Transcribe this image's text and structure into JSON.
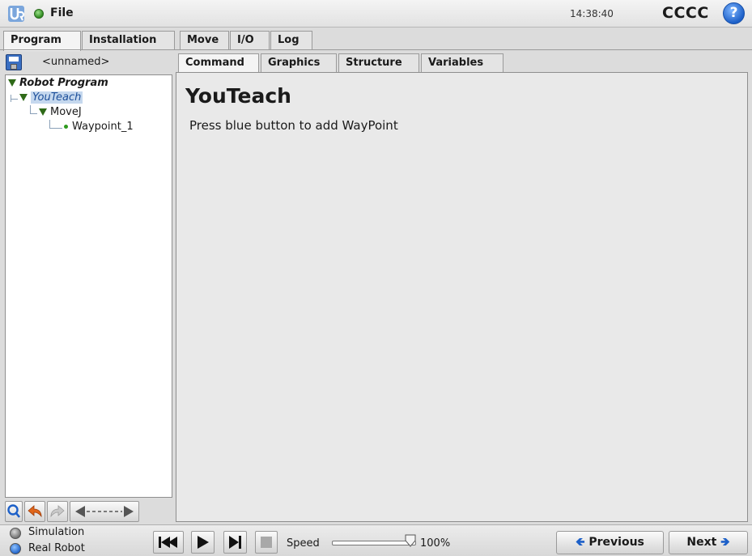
{
  "topbar": {
    "file_label": "File",
    "clock": "14:38:40",
    "robot_name": "CCCC",
    "help_label": "?"
  },
  "main_tabs": [
    "Program",
    "Installation",
    "Move",
    "I/O",
    "Log"
  ],
  "program": {
    "name": "<unnamed>"
  },
  "tree": {
    "root": "Robot Program",
    "youteach": "YouTeach",
    "movej": "MoveJ",
    "waypoint": "Waypoint_1"
  },
  "sub_tabs": [
    "Command",
    "Graphics",
    "Structure",
    "Variables"
  ],
  "content": {
    "title": "YouTeach",
    "description": "Press blue button to add WayPoint"
  },
  "bottom": {
    "simulation": "Simulation",
    "real_robot": "Real Robot",
    "speed_label": "Speed",
    "speed_value": "100%",
    "speed_fraction": 1.0,
    "previous": "Previous",
    "next": "Next"
  },
  "colors": {
    "accent_blue": "#1d60c8",
    "tree_green": "#2f6a18",
    "selection": "#c5d8ee"
  }
}
